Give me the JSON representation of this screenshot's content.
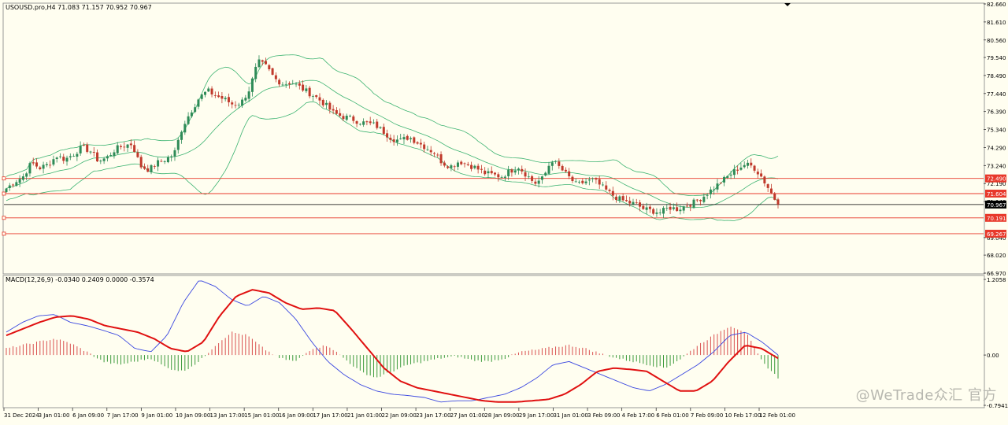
{
  "chart_data": [
    {
      "type": "candlestick",
      "symbol_header": "USOUSD.pro,H4  71.083 71.157 70.952 70.967",
      "overlays": [
        "bollinger-upper",
        "bollinger-middle",
        "bollinger-lower"
      ],
      "ylim": [
        66.97,
        82.66
      ],
      "y_ticks": [
        "82.660",
        "81.610",
        "80.560",
        "79.540",
        "78.490",
        "77.440",
        "76.390",
        "75.340",
        "74.290",
        "73.240",
        "72.190",
        "71.140",
        "69.040",
        "68.020",
        "66.970"
      ],
      "x_ticks": [
        "31 Dec 2024",
        "3 Jan 01:00",
        "6 Jan 09:00",
        "7 Jan 17:00",
        "9 Jan 01:00",
        "10 Jan 09:00",
        "13 Jan 17:00",
        "15 Jan 01:00",
        "16 Jan 09:00",
        "17 Jan 17:00",
        "21 Jan 01:00",
        "22 Jan 09:00",
        "23 Jan 17:00",
        "27 Jan 01:00",
        "28 Jan 09:00",
        "29 Jan 17:00",
        "31 Jan 01:00",
        "3 Feb 09:00",
        "4 Feb 17:00",
        "6 Feb 01:00",
        "7 Feb 09:00",
        "10 Feb 17:00",
        "12 Feb 01:00"
      ],
      "close_path": [
        71.9,
        72.3,
        72.6,
        73.4,
        73.1,
        73.3,
        73.8,
        73.6,
        73.9,
        74.3,
        74.1,
        73.5,
        73.7,
        74.2,
        74.4,
        74.5,
        73.2,
        73.0,
        73.4,
        73.6,
        73.9,
        75.5,
        76.4,
        77.2,
        77.6,
        77.3,
        77.1,
        76.8,
        76.9,
        77.7,
        79.3,
        79.0,
        78.3,
        78.0,
        78.1,
        77.8,
        77.5,
        77.2,
        76.8,
        76.3,
        76.1,
        76.0,
        75.8,
        75.7,
        75.6,
        75.2,
        74.8,
        74.7,
        74.9,
        74.6,
        74.3,
        74.0,
        73.4,
        73.2,
        73.5,
        73.3,
        73.1,
        72.8,
        72.7,
        72.6,
        72.9,
        73.2,
        72.7,
        72.2,
        72.5,
        73.6,
        73.1,
        72.6,
        72.1,
        72.3,
        72.4,
        72.0,
        71.6,
        71.3,
        71.1,
        71.0,
        70.7,
        70.6,
        70.5,
        70.8,
        70.7,
        70.9,
        71.1,
        71.4,
        71.8,
        72.2,
        72.6,
        73.0,
        73.3,
        73.2,
        72.6,
        71.8,
        70.97
      ],
      "price_lines": [
        {
          "label": "72.490",
          "value": 72.49
        },
        {
          "label": "71.604",
          "value": 71.604
        },
        {
          "label": "70.967",
          "value": 70.967
        },
        {
          "label": "70.191",
          "value": 70.191
        },
        {
          "label": "69.267",
          "value": 69.267
        }
      ],
      "colors": {
        "up": "#2e8b57",
        "down": "#c0392b",
        "band": "#3cb371",
        "level_line": "#e8392b",
        "current_price": "#000000",
        "label_bg": "#e8392b"
      }
    },
    {
      "type": "macd",
      "header": "MACD(12,26,9) -0.0340 0.2409 0.0000 -0.3574",
      "ylim": [
        -0.7941,
        1.2058
      ],
      "y_ticks": [
        "1.2058",
        "0.00",
        "-0.7941"
      ],
      "signal_path": [
        0.3,
        0.4,
        0.5,
        0.58,
        0.6,
        0.55,
        0.45,
        0.4,
        0.35,
        0.25,
        0.1,
        0.05,
        0.2,
        0.6,
        0.9,
        1.0,
        0.95,
        0.8,
        0.7,
        0.72,
        0.68,
        0.4,
        0.1,
        -0.2,
        -0.4,
        -0.5,
        -0.55,
        -0.6,
        -0.65,
        -0.7,
        -0.72,
        -0.72,
        -0.7,
        -0.68,
        -0.6,
        -0.45,
        -0.25,
        -0.2,
        -0.22,
        -0.25,
        -0.4,
        -0.55,
        -0.55,
        -0.4,
        -0.1,
        0.15,
        0.1,
        -0.05
      ],
      "macd_path": [
        0.35,
        0.5,
        0.6,
        0.62,
        0.5,
        0.45,
        0.38,
        0.3,
        0.1,
        0.05,
        0.3,
        0.8,
        1.15,
        1.05,
        0.85,
        0.75,
        0.9,
        0.8,
        0.55,
        0.2,
        -0.1,
        -0.3,
        -0.45,
        -0.55,
        -0.6,
        -0.62,
        -0.65,
        -0.72,
        -0.7,
        -0.7,
        -0.65,
        -0.6,
        -0.5,
        -0.35,
        -0.15,
        -0.1,
        -0.2,
        -0.3,
        -0.4,
        -0.5,
        -0.55,
        -0.45,
        -0.3,
        -0.15,
        0.05,
        0.3,
        0.35,
        0.2,
        0.0
      ],
      "histogram_path": [
        0.1,
        0.15,
        0.2,
        0.25,
        0.18,
        0.05,
        -0.1,
        -0.15,
        -0.1,
        -0.05,
        -0.2,
        -0.25,
        -0.1,
        0.15,
        0.35,
        0.3,
        0.1,
        -0.05,
        -0.1,
        0.1,
        0.15,
        -0.05,
        -0.25,
        -0.35,
        -0.25,
        -0.15,
        -0.1,
        -0.05,
        -0.02,
        -0.08,
        -0.1,
        -0.05,
        0.05,
        0.08,
        0.12,
        0.15,
        0.1,
        0.02,
        -0.05,
        -0.1,
        -0.15,
        -0.2,
        -0.05,
        0.15,
        0.3,
        0.45,
        0.35,
        -0.1,
        -0.35
      ],
      "colors": {
        "macd_line": "#3a47e0",
        "signal_line": "#e01010",
        "hist_up": "#d95050",
        "hist_down": "#3c9a3c"
      }
    }
  ],
  "watermark": {
    "text": "@WeTrade众汇 官方"
  }
}
